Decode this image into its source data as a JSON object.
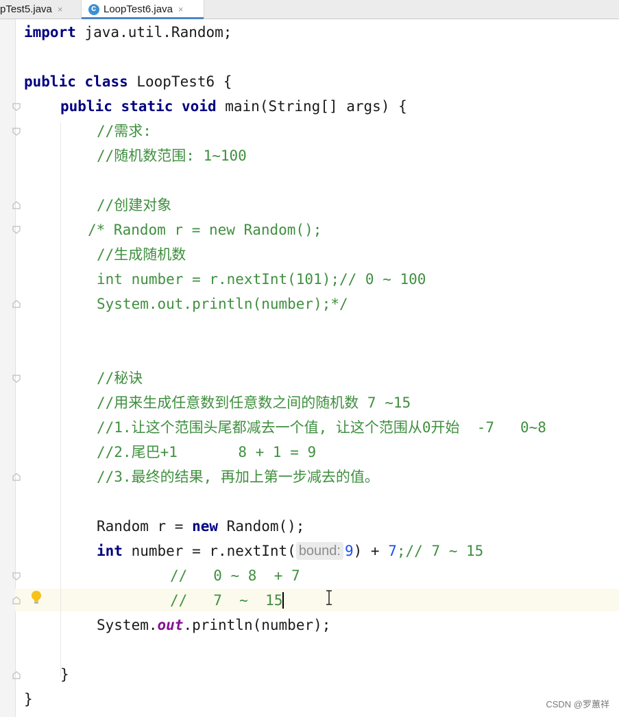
{
  "tabs": [
    {
      "label": "pTest5.java",
      "close": "×",
      "active": false
    },
    {
      "label": "LoopTest6.java",
      "close": "×",
      "active": true
    }
  ],
  "code": {
    "l1": {
      "kw": "import",
      "rest": " java.util.Random;"
    },
    "l2": {
      "kw1": "public",
      "kw2": "class",
      "rest": " LoopTest6 {"
    },
    "l3": {
      "kw1": "public",
      "kw2": "static",
      "kw3": "void",
      "rest": " main(String[] args) {"
    },
    "l4": "//需求:",
    "l5": "//随机数范围: 1~100",
    "l6": "//创建对象",
    "l7": "/* Random r = new Random();",
    "l8": "//生成随机数",
    "l9": "int number = r.nextInt(101);// 0 ~ 100",
    "l10": "System.out.println(number);*/",
    "l11": "//秘诀",
    "l12": "//用来生成任意数到任意数之间的随机数 7 ~15",
    "l13": "//1.让这个范围头尾都减去一个值, 让这个范围从0开始  -7   0~8",
    "l14": "//2.尾巴+1       8 + 1 = 9",
    "l15": "//3.最终的结果, 再加上第一步减去的值。",
    "l16": {
      "pre": "Random r = ",
      "kw": "new",
      "post": " Random();"
    },
    "l17": {
      "kw": "int",
      "pre": " number = r.nextInt(",
      "hint": "bound:",
      "arg": "9",
      "mid": ") + ",
      "num": "7",
      "comment": ";// 7 ~ 15"
    },
    "l18": "//   0 ~ 8  + 7",
    "l19": "//   7  ~  15",
    "l20": {
      "pre": "System.",
      "field": "out",
      "post": ".println(number);"
    },
    "l21": "}",
    "l22": "}"
  },
  "watermark": "CSDN @罗蕙祥"
}
